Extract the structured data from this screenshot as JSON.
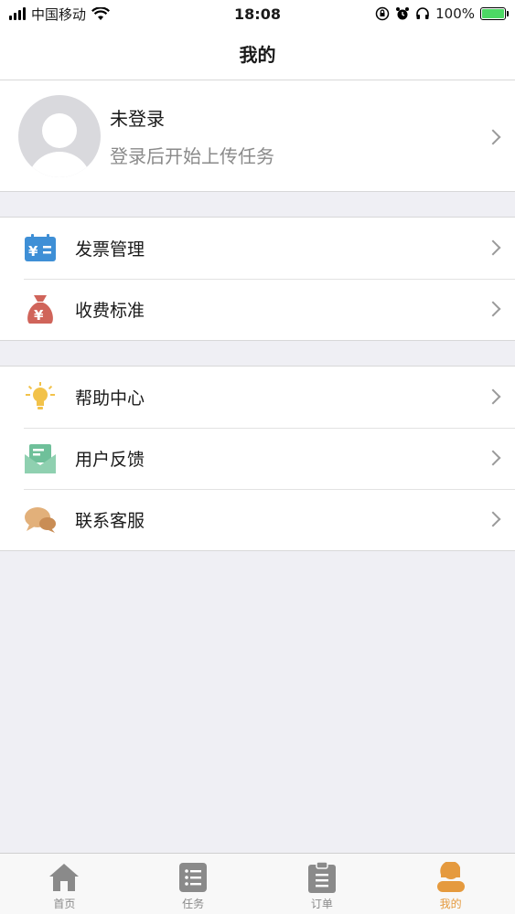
{
  "status_bar": {
    "carrier": "中国移动",
    "time": "18:08",
    "battery": "100%"
  },
  "nav": {
    "title": "我的"
  },
  "profile": {
    "name": "未登录",
    "hint": "登录后开始上传任务"
  },
  "menu_groups": [
    {
      "items": [
        {
          "label": "发票管理",
          "icon": "invoice-icon",
          "color": "#3e8fd6"
        },
        {
          "label": "收费标准",
          "icon": "money-bag-icon",
          "color": "#d0645a"
        }
      ]
    },
    {
      "items": [
        {
          "label": "帮助中心",
          "icon": "lightbulb-icon",
          "color": "#f2c24a"
        },
        {
          "label": "用户反馈",
          "icon": "feedback-mail-icon",
          "color": "#6fc09a"
        },
        {
          "label": "联系客服",
          "icon": "chat-bubbles-icon",
          "color": "#d9a36a"
        }
      ]
    }
  ],
  "tabs": [
    {
      "label": "首页",
      "icon": "home-icon"
    },
    {
      "label": "任务",
      "icon": "task-list-icon"
    },
    {
      "label": "订单",
      "icon": "order-clipboard-icon"
    },
    {
      "label": "我的",
      "icon": "profile-icon",
      "active": true
    }
  ],
  "colors": {
    "accent": "#e59a3e",
    "inactive": "#8a8a8a",
    "background": "#efeff4"
  }
}
